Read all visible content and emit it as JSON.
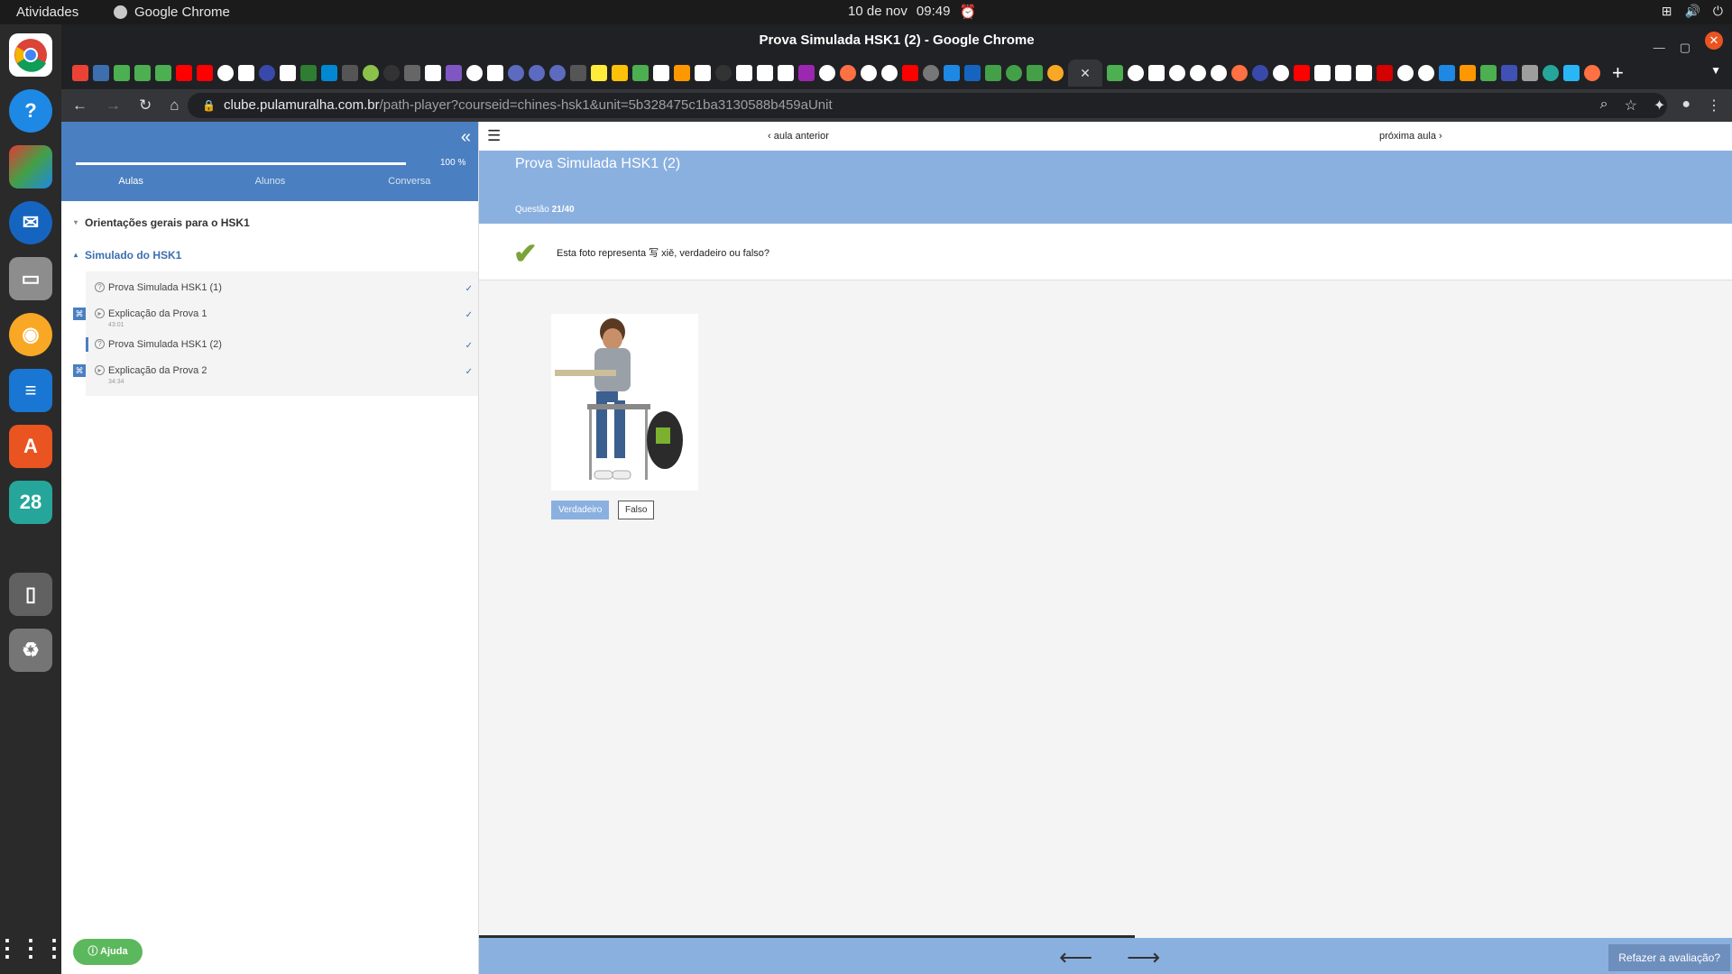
{
  "os": {
    "activities": "Atividades",
    "app_name": "Google Chrome",
    "date": "10 de nov",
    "time": "09:49"
  },
  "window": {
    "title": "Prova Simulada HSK1 (2) - Google Chrome"
  },
  "address": {
    "domain": "clube.pulamuralha.com.br",
    "path": "/path-player?courseid=chines-hsk1&unit=5b328475c1ba3130588b459aUnit"
  },
  "sidebar": {
    "progress_pct": "100 %",
    "progress_fraction": 1.0,
    "tabs": [
      "Aulas",
      "Alunos",
      "Conversa"
    ],
    "sections": [
      "Orientações gerais para o HSK1",
      "Simulado do HSK1"
    ],
    "lessons": [
      {
        "title": "Prova Simulada HSK1 (1)",
        "duration": ""
      },
      {
        "title": "Explicação da Prova 1",
        "duration": "43:01"
      },
      {
        "title": "Prova Simulada HSK1 (2)",
        "duration": ""
      },
      {
        "title": "Explicação da Prova 2",
        "duration": "34:34"
      }
    ],
    "help": "Ajuda"
  },
  "main": {
    "prev": "aula anterior",
    "next": "próxima aula",
    "title": "Prova Simulada HSK1 (2)",
    "question_label": "Questão",
    "question_num": "21/40",
    "question_text": "Esta foto representa 写 xiě, verdadeiro ou falso?",
    "answer_true": "Verdadeiro",
    "answer_false": "Falso",
    "redo": "Refazer a avaliação?"
  },
  "colors": {
    "accent": "#4a7fc1",
    "header": "#8ab0e0",
    "check": "#7aa33a",
    "help": "#5cb85c"
  }
}
